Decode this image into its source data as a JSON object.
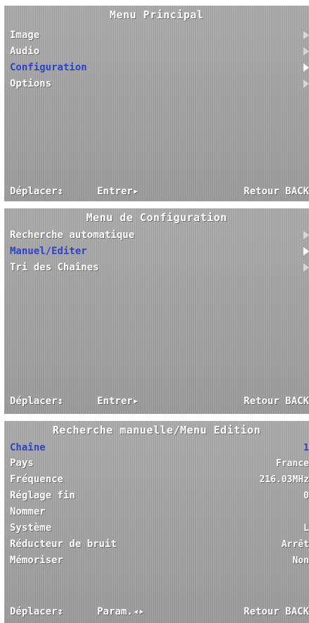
{
  "screens": [
    {
      "title": "Menu Principal",
      "items": [
        {
          "label": "Image"
        },
        {
          "label": "Audio"
        },
        {
          "label": "Configuration"
        },
        {
          "label": "Options"
        }
      ],
      "footer": {
        "move": "Déplacer↕",
        "enter": "Entrer▸",
        "back": "Retour BACK"
      }
    },
    {
      "title": "Menu de Configuration",
      "items": [
        {
          "label": "Recherche automatique"
        },
        {
          "label": "Manuel/Editer"
        },
        {
          "label": "Tri des Chaînes"
        }
      ],
      "footer": {
        "move": "Déplacer↕",
        "enter": "Entrer▸",
        "back": "Retour BACK"
      }
    },
    {
      "title": "Recherche manuelle/Menu Edition",
      "rows": [
        {
          "label": "Chaîne",
          "value": "1"
        },
        {
          "label": "Pays",
          "value": "France"
        },
        {
          "label": "Fréquence",
          "value": "216.03MHz"
        },
        {
          "label": "Réglage fin",
          "value": "0"
        },
        {
          "label": "Nommer",
          "value": ""
        },
        {
          "label": "Système",
          "value": "L"
        },
        {
          "label": "Réducteur de bruit",
          "value": "Arrêt"
        },
        {
          "label": "Mémoriser",
          "value": "Non"
        }
      ],
      "footer": {
        "move": "Déplacer↕",
        "enter": "Param.◂▸",
        "back": "Retour BACK"
      }
    }
  ],
  "colors": {
    "highlight": "#2c44c8",
    "text": "#ffffff",
    "background": "#a7a7a7"
  }
}
